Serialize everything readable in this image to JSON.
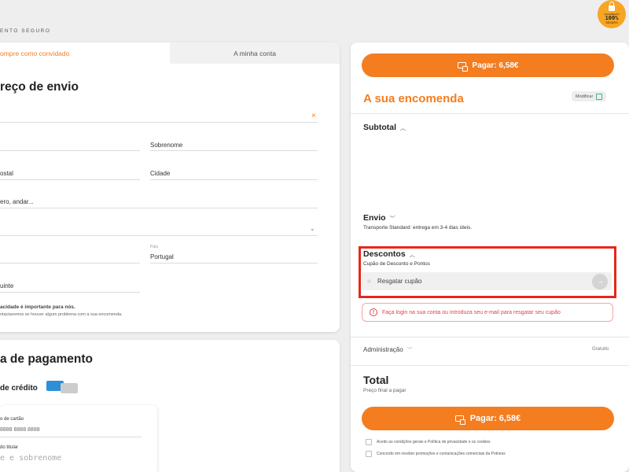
{
  "header": {
    "secure_label": "ENTO SEGURO",
    "badge_line1": "PAGAMENTO",
    "badge_line2": "100%",
    "badge_line3": "SEGURO"
  },
  "checkout_tabs": {
    "guest": "ompre como convidado",
    "account": "A minha conta"
  },
  "shipping": {
    "title": "reço de envio",
    "last_name_label": "Sobrenome",
    "postal_label": "ostal",
    "city_label": "Cidade",
    "address2_label": "ero, andar...",
    "country_small_label": "País",
    "country_value": "Portugal",
    "taxpayer_label": "uinte",
    "privacy_title": "acidade é importante para nós.",
    "privacy_text": "ntactaremos se houver algum problema com a sua encomenda."
  },
  "payment": {
    "title": "a de pagamento",
    "method_label": "de crédito",
    "card_number_label": "o de cartão",
    "card_number_placeholder": "8888 8888 8888",
    "holder_label": "do titular",
    "holder_placeholder": "e e sobrenome"
  },
  "order": {
    "pay_button_label": "Pagar:",
    "pay_amount": "6,58€",
    "title": "A sua encomenda",
    "modify_label": "Modificar",
    "subtotal_label": "Subtotal",
    "shipping_label": "Envio",
    "shipping_desc": "Transporte Standard: entrega em 3-4 dias úteis.",
    "discounts_label": "Descontos",
    "discounts_desc": "Cupão de Desconto e Pontos",
    "redeem_coupon_label": "Resgatar cupão",
    "error_message": "Faça login na sua conta ou introduza seu e-mail para resgatar seu cupão",
    "admin_label": "Administração",
    "admin_value": "Gratuito",
    "total_label": "Total",
    "total_desc": "Preço final a pagar",
    "terms_label": "Aceito as condições gerais e Política de privacidade e os cookies",
    "promo_label": "Concordo em receber promoções e comunicações comerciais da Potness"
  },
  "colors": {
    "accent": "#f47d20",
    "error": "#e04343",
    "highlight": "#e8261b"
  },
  "icons": [
    "lock-icon",
    "card-icon",
    "chevron-up-icon",
    "chevron-down-icon",
    "edit-icon",
    "close-icon",
    "arrow-right-icon",
    "error-icon"
  ]
}
